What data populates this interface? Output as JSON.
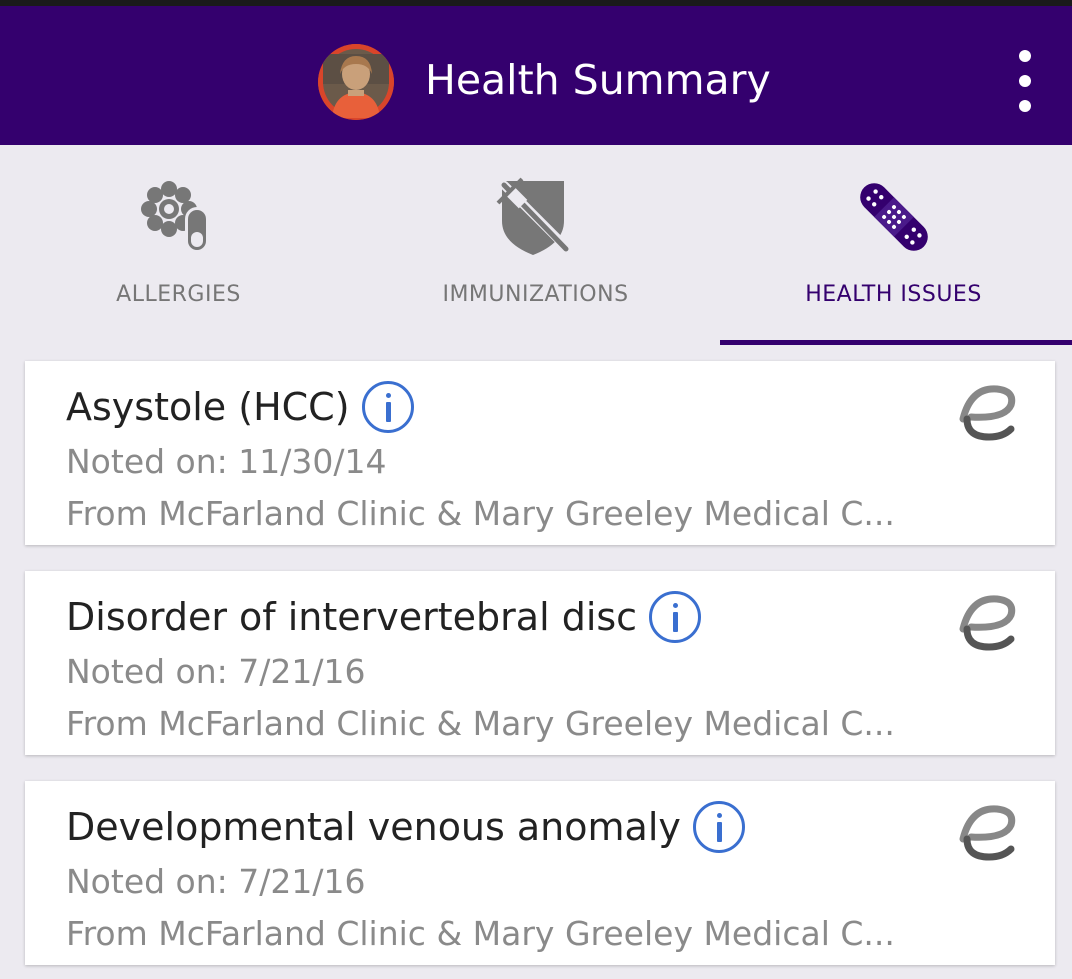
{
  "app_bar": {
    "title": "Health Summary",
    "avatar_icon": "profile-avatar",
    "menu_icon": "more-vert-icon",
    "background": "#34006e"
  },
  "tabs": [
    {
      "label": "ALLERGIES",
      "icon": "allergies-icon",
      "active": false
    },
    {
      "label": "IMMUNIZATIONS",
      "icon": "syringe-shield-icon",
      "active": false
    },
    {
      "label": "HEALTH ISSUES",
      "icon": "bandage-icon",
      "active": true
    }
  ],
  "issues": [
    {
      "title": "Asystole (HCC)",
      "noted": "Noted on: 11/30/14",
      "source": "From McFarland Clinic & Mary Greeley Medical C..."
    },
    {
      "title": "Disorder of intervertebral disc",
      "noted": "Noted on: 7/21/16",
      "source": "From McFarland Clinic & Mary Greeley Medical C..."
    },
    {
      "title": "Developmental venous anomaly",
      "noted": "Noted on: 7/21/16",
      "source": "From McFarland Clinic & Mary Greeley Medical C..."
    }
  ],
  "colors": {
    "accent": "#34006e",
    "info_blue": "#3a6fd0",
    "inactive_tab": "#767676"
  }
}
